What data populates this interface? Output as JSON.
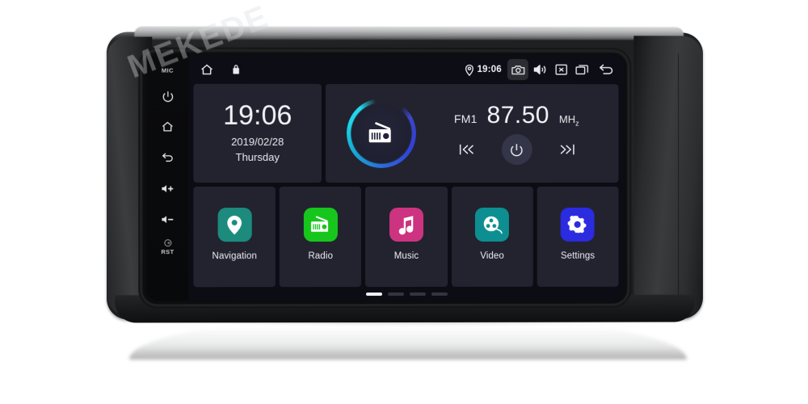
{
  "device": {
    "brand_watermark": "MEKEDE",
    "mic_label": "MIC",
    "reset_label": "RST",
    "hardware_buttons": [
      {
        "name": "power",
        "icon": "power-icon"
      },
      {
        "name": "home",
        "icon": "home-icon"
      },
      {
        "name": "back",
        "icon": "back-arrow-icon"
      },
      {
        "name": "volume-up",
        "icon": "volume-up-icon"
      },
      {
        "name": "volume-down",
        "icon": "volume-down-icon"
      }
    ]
  },
  "status_bar": {
    "home_icon": "home-icon",
    "lock_icon": "lock-icon",
    "location_icon": "location-pin-icon",
    "time": "19:06",
    "camera_icon": "camera-icon",
    "volume_icon": "volume-icon",
    "close_icon": "close-box-icon",
    "recents_icon": "recent-apps-icon",
    "back_icon": "back-arrow-icon"
  },
  "clock_widget": {
    "time": "19:06",
    "date": "2019/02/28",
    "weekday": "Thursday"
  },
  "radio_widget": {
    "icon": "radio-icon",
    "band": "FM1",
    "frequency": "87.50",
    "unit_main": "MH",
    "unit_sub": "z",
    "prev_icon": "previous-track-icon",
    "power_icon": "power-icon",
    "next_icon": "next-track-icon",
    "ring_color_start": "#23d9ea",
    "ring_color_end": "#3a46c8"
  },
  "apps": [
    {
      "label": "Navigation",
      "icon": "location-pin-icon",
      "color": "#1c8b7e"
    },
    {
      "label": "Radio",
      "icon": "radio-icon",
      "color": "#17c61c"
    },
    {
      "label": "Music",
      "icon": "music-note-icon",
      "color": "#cc3380"
    },
    {
      "label": "Video",
      "icon": "film-reel-icon",
      "color": "#0d8f92"
    },
    {
      "label": "Settings",
      "icon": "gear-icon",
      "color": "#2b2be0"
    }
  ],
  "pagination": {
    "total": 4,
    "active_index": 0
  },
  "theme": {
    "screen_background": "#0c0d14",
    "tile_background": "#22232f",
    "text_primary": "#f0f2f5"
  }
}
